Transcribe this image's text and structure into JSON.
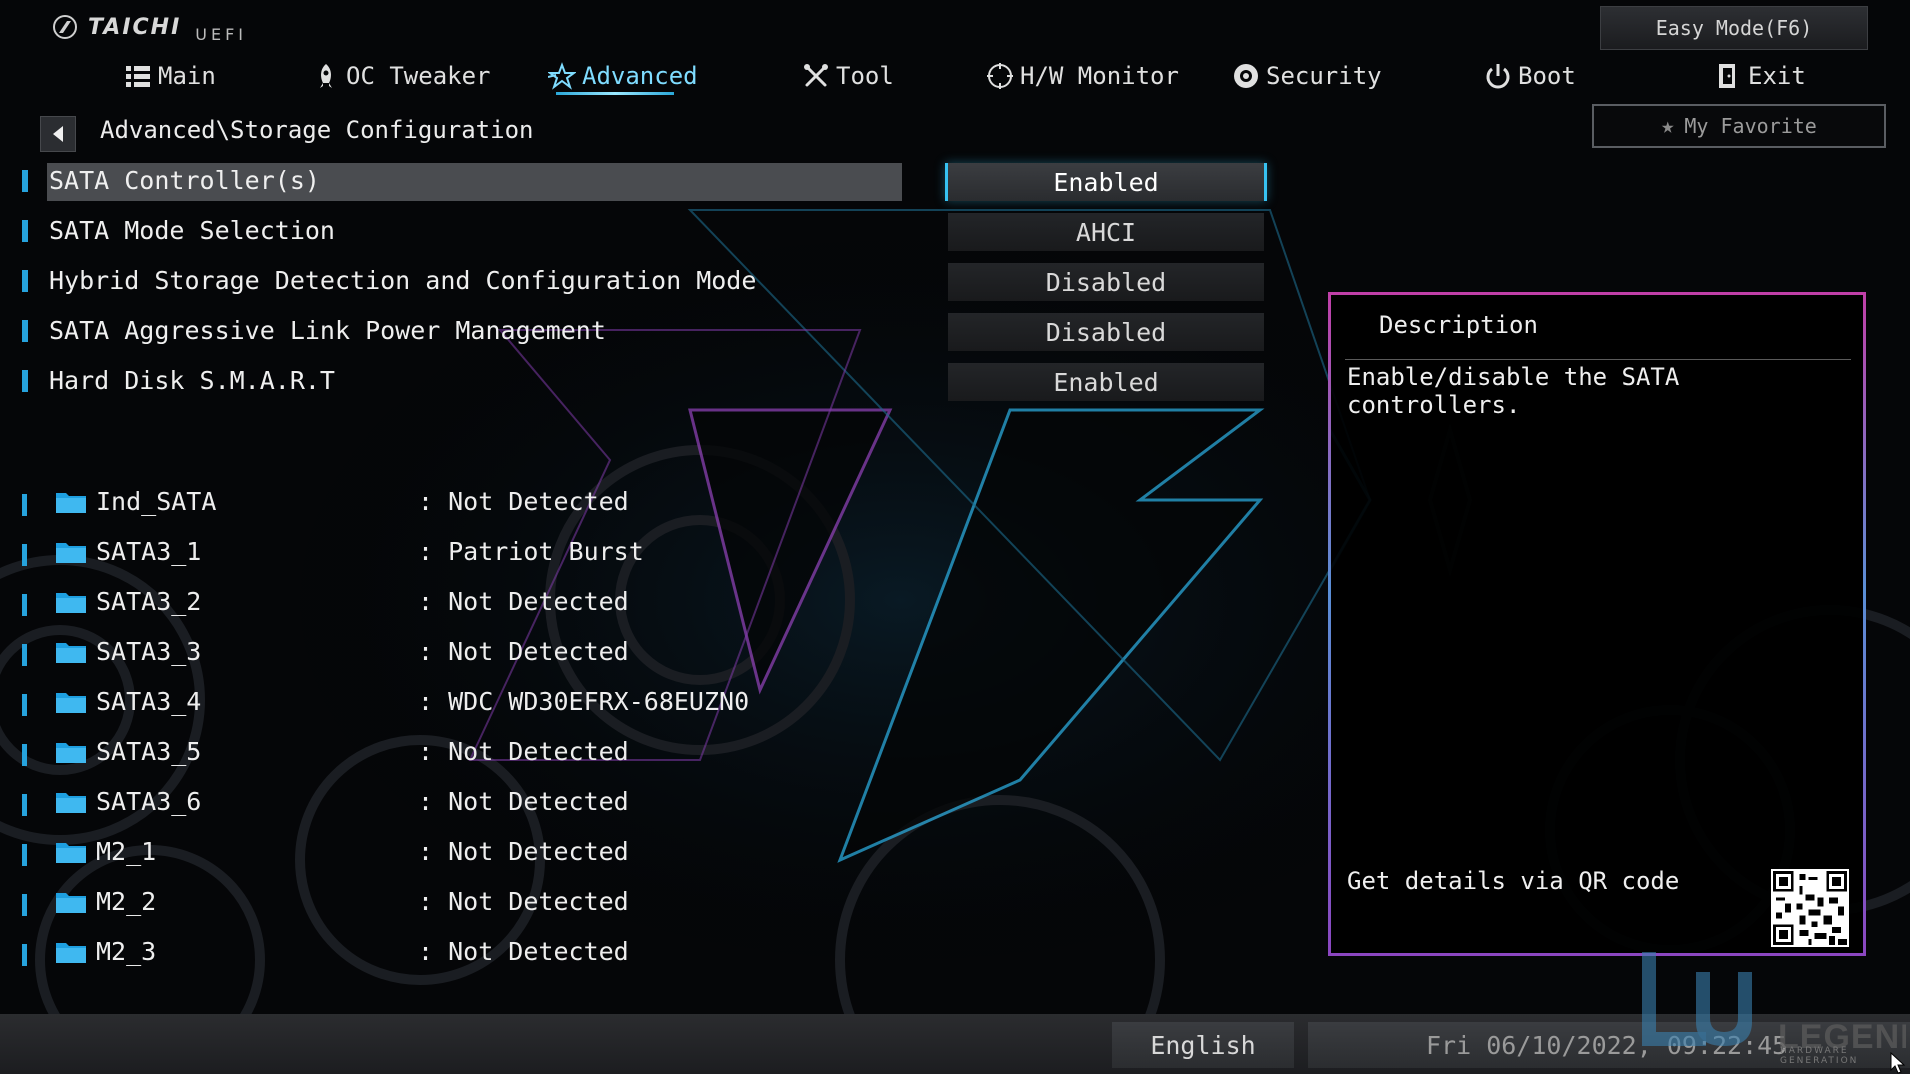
{
  "brand": {
    "name": "TAICHI",
    "sub": "UEFI"
  },
  "header": {
    "easy_mode": "Easy Mode(F6)",
    "favorite": "My Favorite"
  },
  "tabs": [
    {
      "label": "Main",
      "icon": "list-icon"
    },
    {
      "label": "OC Tweaker",
      "icon": "rocket-icon"
    },
    {
      "label": "Advanced",
      "icon": "star-icon",
      "active": true
    },
    {
      "label": "Tool",
      "icon": "tools-icon"
    },
    {
      "label": "H/W Monitor",
      "icon": "monitor-icon"
    },
    {
      "label": "Security",
      "icon": "shield-icon"
    },
    {
      "label": "Boot",
      "icon": "power-icon"
    },
    {
      "label": "Exit",
      "icon": "exit-door-icon"
    }
  ],
  "breadcrumb": "Advanced\\Storage Configuration",
  "settings": [
    {
      "label": "SATA Controller(s)",
      "value": "Enabled",
      "selected": true
    },
    {
      "label": "SATA Mode Selection",
      "value": "AHCI"
    },
    {
      "label": "Hybrid Storage Detection and Configuration Mode",
      "value": "Disabled"
    },
    {
      "label": "SATA Aggressive Link Power Management",
      "value": "Disabled"
    },
    {
      "label": "Hard Disk S.M.A.R.T",
      "value": "Enabled"
    }
  ],
  "drives": [
    {
      "port": "Ind_SATA",
      "status": ": Not Detected"
    },
    {
      "port": "SATA3_1",
      "status": ": Patriot Burst"
    },
    {
      "port": "SATA3_2",
      "status": ": Not Detected"
    },
    {
      "port": "SATA3_3",
      "status": ": Not Detected"
    },
    {
      "port": "SATA3_4",
      "status": ": WDC WD30EFRX-68EUZN0"
    },
    {
      "port": "SATA3_5",
      "status": ": Not Detected"
    },
    {
      "port": "SATA3_6",
      "status": ": Not Detected"
    },
    {
      "port": "M2_1",
      "status": ": Not Detected"
    },
    {
      "port": "M2_2",
      "status": ": Not Detected"
    },
    {
      "port": "M2_3",
      "status": ": Not Detected"
    }
  ],
  "description": {
    "title": "Description",
    "text": "Enable/disable the SATA controllers.",
    "qr_text": "Get details via QR code"
  },
  "footer": {
    "language": "English",
    "datetime": "Fri 06/10/2022, 09:22:45"
  },
  "watermark": {
    "text": "LEGEND",
    "sub": "HARDWARE GENERATION"
  },
  "colors": {
    "accent": "#26a3dd",
    "active_tab": "#7fdcff",
    "desc_border_top": "#c03fa8",
    "desc_border_mid": "#5a8fd6"
  }
}
